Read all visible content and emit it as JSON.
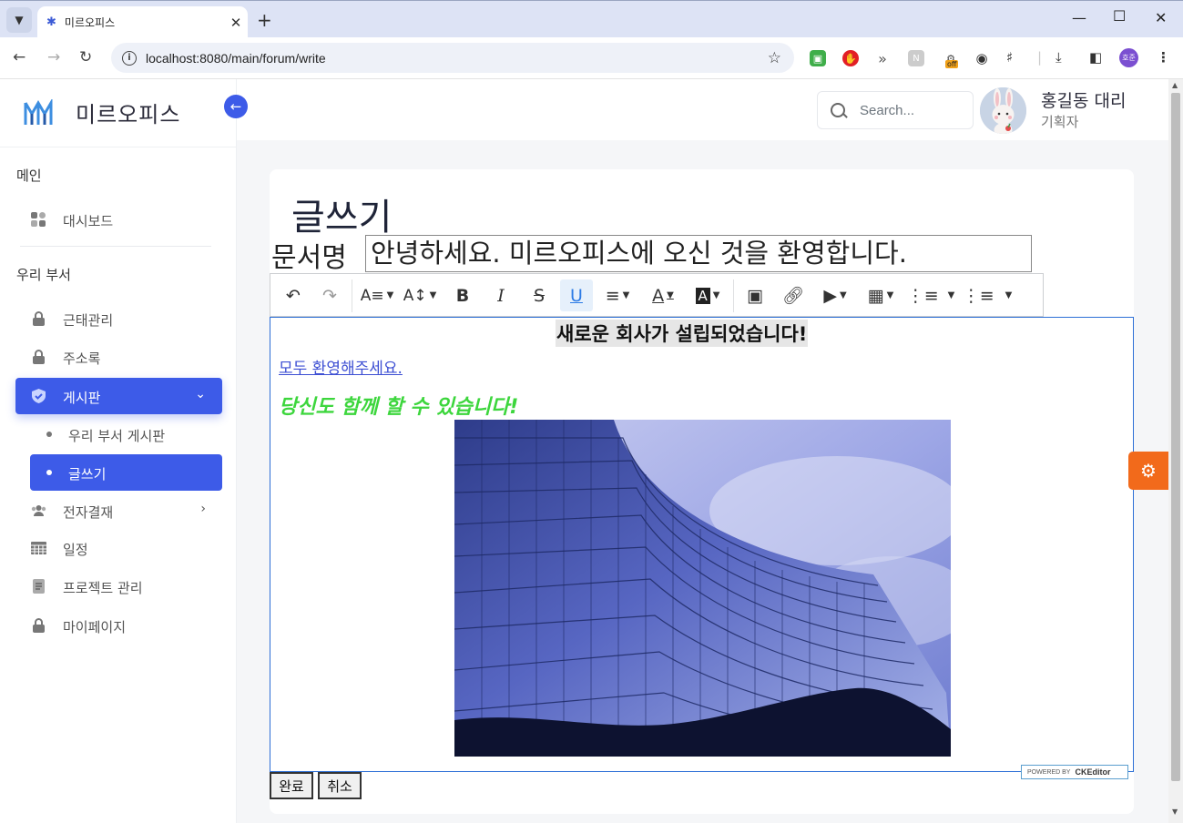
{
  "browser": {
    "tab_title": "미르오피스",
    "url": "localhost:8080/main/forum/write",
    "profile_initials": "호준",
    "ext_badge": "off"
  },
  "brand": {
    "name": "미르오피스"
  },
  "sidebar": {
    "section_main": "메인",
    "dashboard": "대시보드",
    "section_dept": "우리 부서",
    "items": [
      {
        "label": "근태관리",
        "icon": "lock-icon"
      },
      {
        "label": "주소록",
        "icon": "lock-icon"
      },
      {
        "label": "게시판",
        "icon": "shield-icon"
      }
    ],
    "sub_items": [
      {
        "label": "우리 부서 게시판"
      },
      {
        "label": "글쓰기"
      }
    ],
    "items_after": [
      {
        "label": "전자결재",
        "icon": "users-icon"
      },
      {
        "label": "일정",
        "icon": "calendar-icon"
      },
      {
        "label": "프로젝트 관리",
        "icon": "document-icon"
      },
      {
        "label": "마이페이지",
        "icon": "lock-icon"
      }
    ]
  },
  "header": {
    "search_placeholder": "Search...",
    "user_name": "홍길동 대리",
    "user_role": "기획자"
  },
  "page": {
    "title": "글쓰기",
    "doc_label": "문서명",
    "doc_value": "안녕하세요. 미르오피스에 오신 것을 환영합니다."
  },
  "editor": {
    "heading": "새로운 회사가 설립되었습니다!",
    "link_text": "모두 환영해주세요.",
    "green_text": "당신도 함께 할 수 있습니다!",
    "green_color": "#3dd63d",
    "image_alt": "glass office building",
    "powered": "POWERED BY",
    "powered_brand": "CKEditor"
  },
  "buttons": {
    "submit": "완료",
    "cancel": "취소"
  },
  "colors": {
    "accent": "#3d5be8",
    "fab": "#f26a1b"
  }
}
